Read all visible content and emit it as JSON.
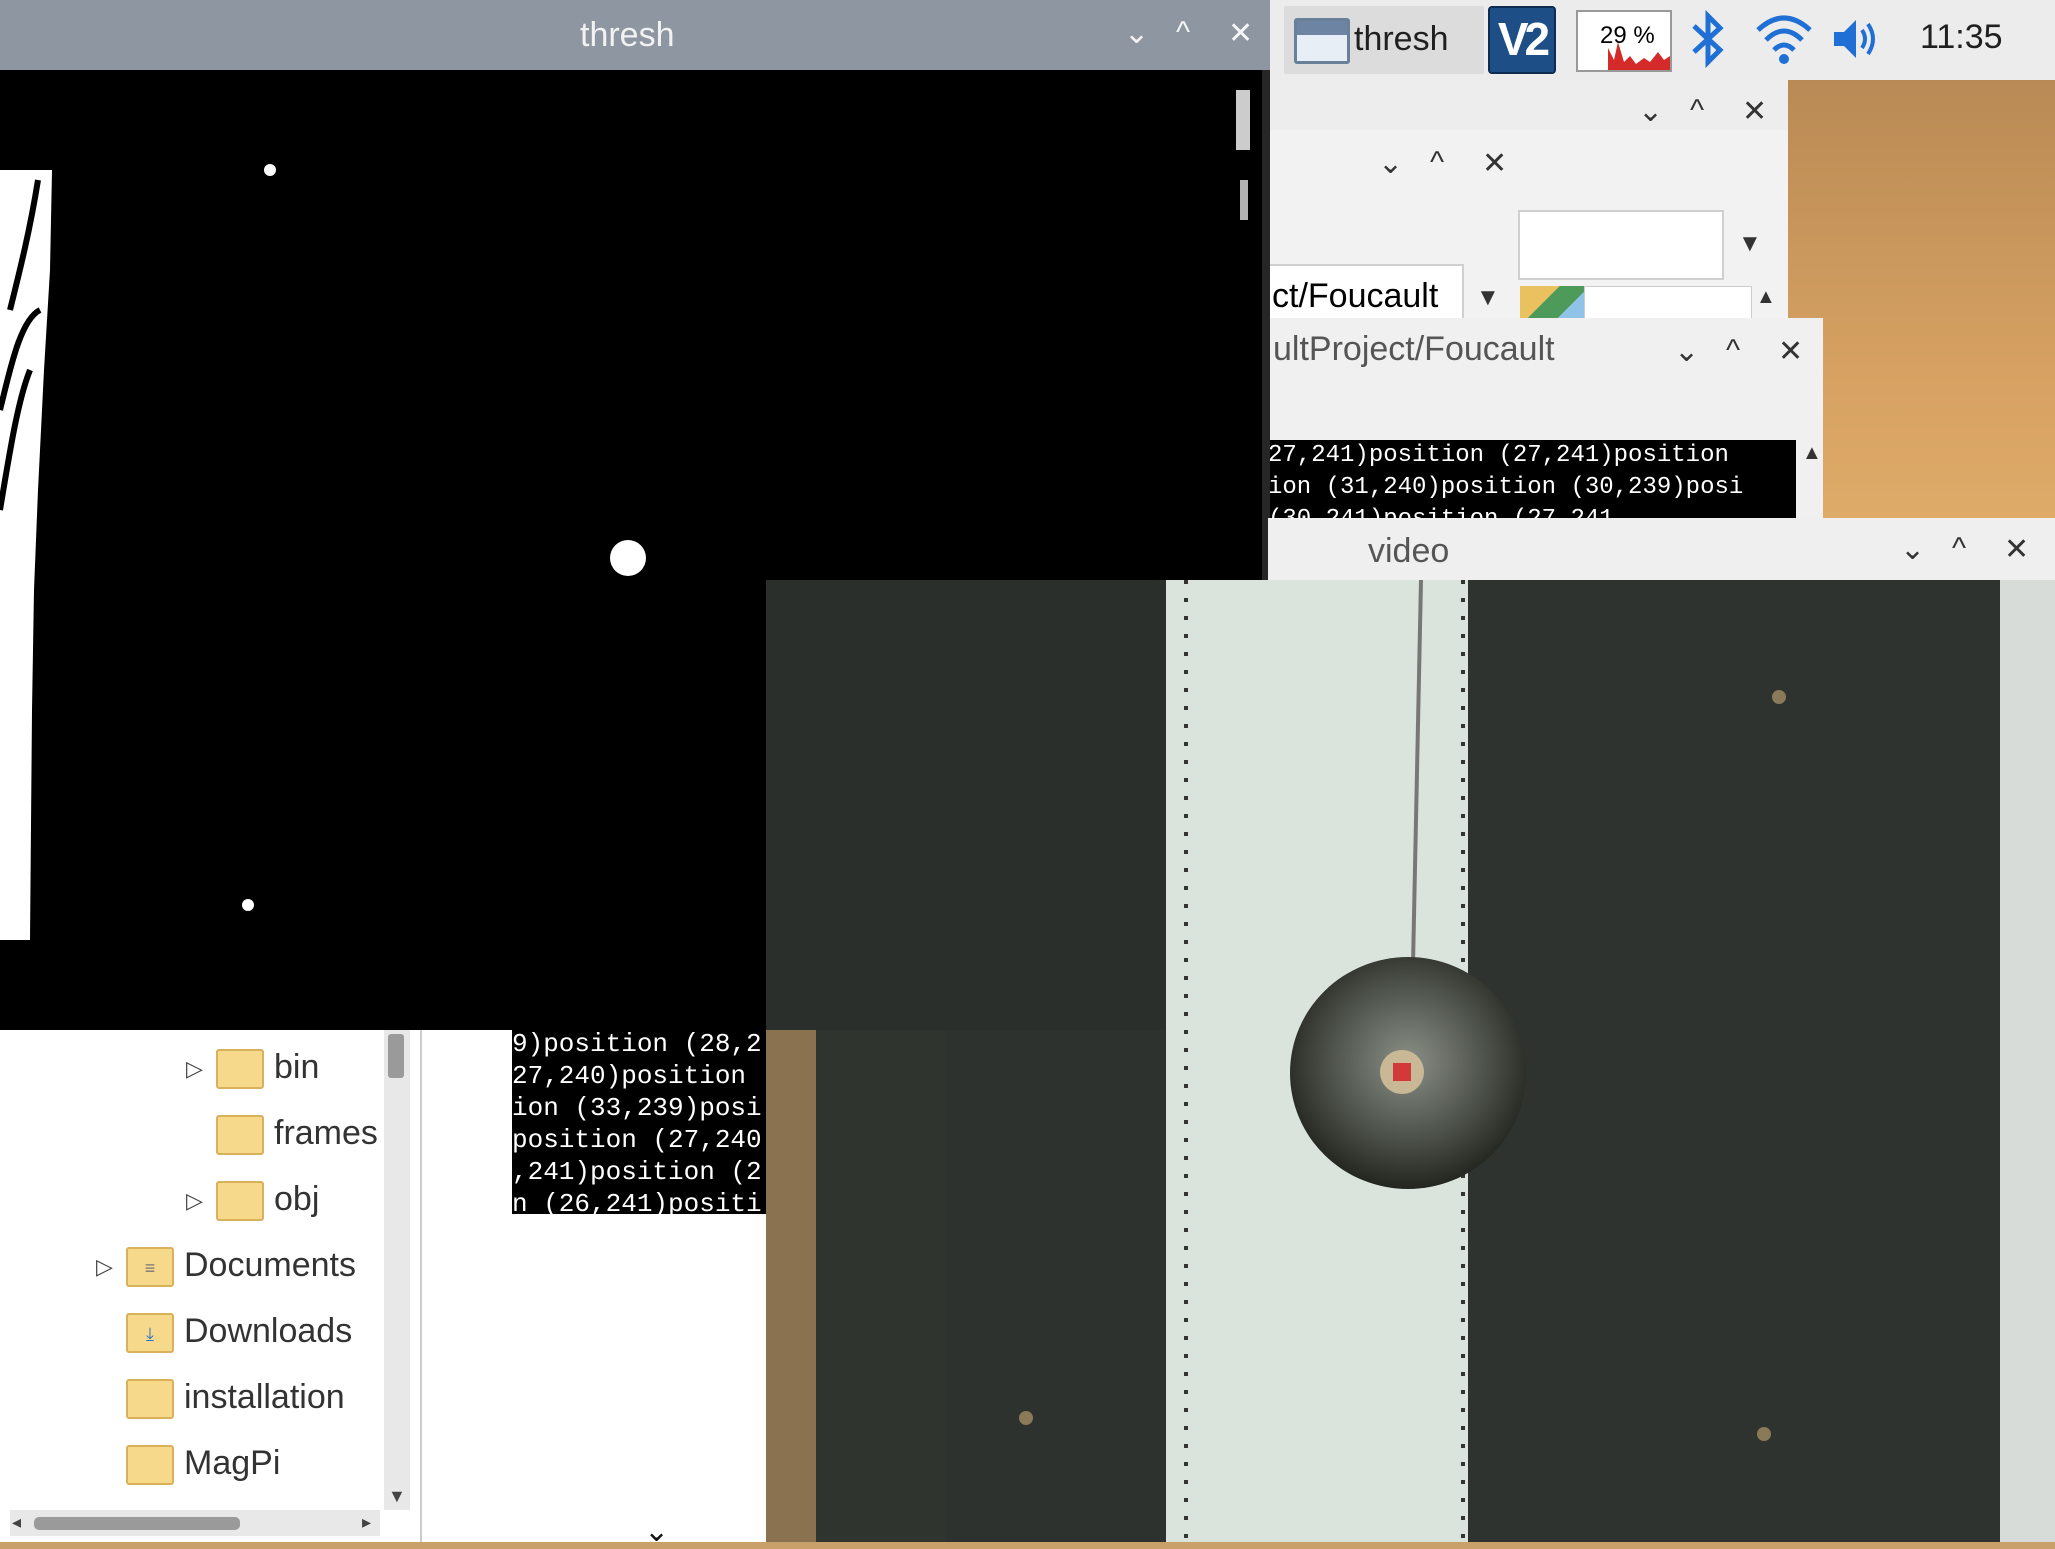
{
  "taskbar": {
    "app_label": "thresh",
    "vnc_label": "V2",
    "cpu_percent": "29 %",
    "clock": "11:35"
  },
  "thresh_window": {
    "title": "thresh",
    "controls": [
      "⌄",
      "^",
      "✕"
    ]
  },
  "bg_window_1": {
    "controls": [
      "⌄",
      "^",
      "✕"
    ]
  },
  "bg_window_2": {
    "controls": [
      "⌄",
      "^",
      "✕"
    ],
    "path_text": "ct/Foucault"
  },
  "bg_window_3": {
    "title": "ultProject/Foucault",
    "controls": [
      "⌄",
      "^",
      "✕"
    ],
    "terminal_lines": [
      "27,241)position (27,241)position",
      "ion (31,240)position (30,239)posi",
      "   (30,241)position (27,241"
    ]
  },
  "video_window": {
    "title": "video",
    "controls": [
      "⌄",
      "^",
      "✕"
    ]
  },
  "file_tree": {
    "items": [
      {
        "label": "bin",
        "expandable": true
      },
      {
        "label": "frames",
        "expandable": false
      },
      {
        "label": "obj",
        "expandable": true
      },
      {
        "label": "Documents",
        "expandable": true
      },
      {
        "label": "Downloads",
        "expandable": false
      },
      {
        "label": "installation",
        "expandable": false
      },
      {
        "label": "MagPi",
        "expandable": false
      }
    ]
  },
  "terminal_fragment": {
    "lines": [
      "9)position (28,2",
      "27,240)position",
      "ion (33,239)posi",
      "position (27,240",
      ",241)position (2",
      "n (26,241)positi"
    ]
  },
  "colors": {
    "thresh_titlebar": "#8e97a1",
    "vnc_blue": "#1d4f86",
    "bluetooth_blue": "#1f6fd4",
    "folder_yellow": "#f7d98b"
  }
}
